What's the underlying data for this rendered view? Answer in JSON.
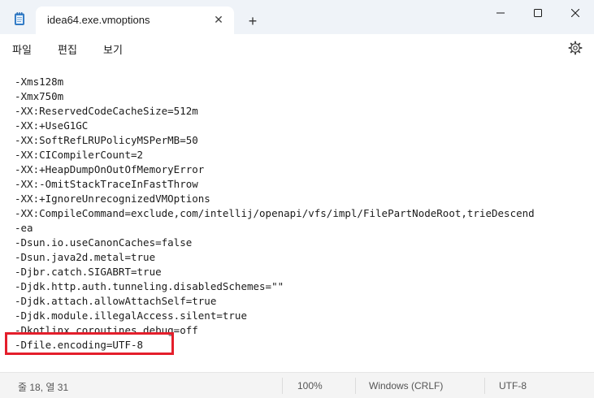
{
  "window": {
    "tab_title": "idea64.exe.vmoptions",
    "new_tab": "+",
    "close_tab": "✕"
  },
  "menu": {
    "file": "파일",
    "edit": "편집",
    "view": "보기"
  },
  "editor": {
    "lines": [
      "-Xms128m",
      "-Xmx750m",
      "-XX:ReservedCodeCacheSize=512m",
      "-XX:+UseG1GC",
      "-XX:SoftRefLRUPolicyMSPerMB=50",
      "-XX:CICompilerCount=2",
      "-XX:+HeapDumpOnOutOfMemoryError",
      "-XX:-OmitStackTraceInFastThrow",
      "-XX:+IgnoreUnrecognizedVMOptions",
      "-XX:CompileCommand=exclude,com/intellij/openapi/vfs/impl/FilePartNodeRoot,trieDescend",
      "-ea",
      "-Dsun.io.useCanonCaches=false",
      "-Dsun.java2d.metal=true",
      "-Djbr.catch.SIGABRT=true",
      "-Djdk.http.auth.tunneling.disabledSchemes=\"\"",
      "-Djdk.attach.allowAttachSelf=true",
      "-Djdk.module.illegalAccess.silent=true",
      "-Dkotlinx.coroutines.debug=off",
      "-Dfile.encoding=UTF-8"
    ],
    "highlight_color": "#e41e2b"
  },
  "status": {
    "position": "줄 18, 열 31",
    "zoom": "100%",
    "line_ending": "Windows (CRLF)",
    "encoding": "UTF-8"
  },
  "icons": {
    "app": "notepad-icon",
    "minimize": "minimize-icon",
    "maximize": "maximize-icon",
    "close": "close-icon",
    "settings": "gear-icon"
  }
}
